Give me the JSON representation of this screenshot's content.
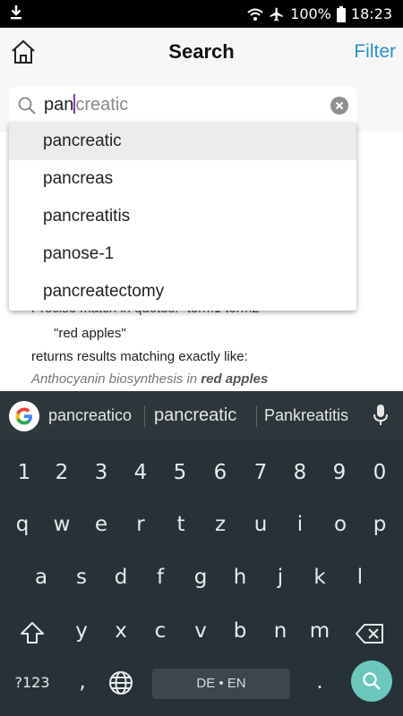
{
  "status_bar": {
    "battery_percent": "100%",
    "time": "18:23",
    "icons": [
      "download-icon",
      "wifi-icon",
      "airplane-icon",
      "battery-icon"
    ]
  },
  "header": {
    "title": "Search",
    "filter_label": "Filter"
  },
  "search": {
    "typed": "pan",
    "completion_hint": "creatic"
  },
  "suggestions": [
    "pancreatic",
    "pancreas",
    "pancreatitis",
    "panose-1",
    "pancreatectomy"
  ],
  "help": {
    "partial_line": "Precise match in quotes: \"term1 term2\"",
    "quote_example": "\"red apples\"",
    "line2": "returns results matching exactly like:",
    "example_prefix": "Anthocyanin biosynthesis in ",
    "example_bold": "red apples"
  },
  "keyboard": {
    "suggestions": [
      "pancreatico",
      "pancreatic",
      "Pankreatitis"
    ],
    "number_row": [
      "1",
      "2",
      "3",
      "4",
      "5",
      "6",
      "7",
      "8",
      "9",
      "0"
    ],
    "row1": [
      "q",
      "w",
      "e",
      "r",
      "t",
      "z",
      "u",
      "i",
      "o",
      "p"
    ],
    "row2": [
      "a",
      "s",
      "d",
      "f",
      "g",
      "h",
      "j",
      "k",
      "l"
    ],
    "row3": [
      "y",
      "x",
      "c",
      "v",
      "b",
      "n",
      "m"
    ],
    "symbols_key": "?123",
    "comma": ",",
    "period": ".",
    "space_label": "DE • EN"
  },
  "colors": {
    "accent": "#2a8fd0",
    "keyboard_bg": "#263238",
    "search_key": "#6cc7bd"
  }
}
